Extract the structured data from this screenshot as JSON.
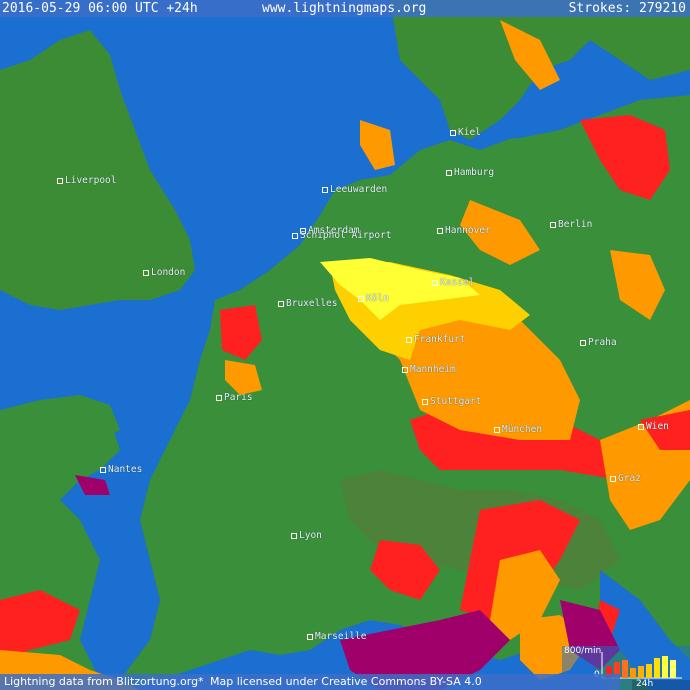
{
  "header": {
    "datetime": "2016-05-29 06:00 UTC +24h",
    "site": "www.lightningmaps.org",
    "strokes_label": "Strokes: 279210"
  },
  "footer": {
    "source_credit": "Lightning data from Blitzortung.org",
    "separator": "*",
    "license_credit": "Map licensed under Creative Commons BY-SA 4.0"
  },
  "cities": [
    {
      "name": "Liverpool",
      "key": "liverpool"
    },
    {
      "name": "London",
      "key": "london"
    },
    {
      "name": "Leeuwarden",
      "key": "leeuwarden"
    },
    {
      "name": "Amsterdam",
      "key": "amsterdam"
    },
    {
      "name": "Schiphol Airport",
      "key": "schiphol"
    },
    {
      "name": "Bruxelles",
      "key": "bruxelles"
    },
    {
      "name": "Köln",
      "key": "koln"
    },
    {
      "name": "Kiel",
      "key": "kiel"
    },
    {
      "name": "Hamburg",
      "key": "hamburg"
    },
    {
      "name": "Hannover",
      "key": "hannover"
    },
    {
      "name": "Berlin",
      "key": "berlin"
    },
    {
      "name": "Kassel",
      "key": "kassel"
    },
    {
      "name": "Frankfurt",
      "key": "frankfurt"
    },
    {
      "name": "Mannheim",
      "key": "mannheim"
    },
    {
      "name": "Stuttgart",
      "key": "stuttgart"
    },
    {
      "name": "München",
      "key": "munchen"
    },
    {
      "name": "Praha",
      "key": "praha"
    },
    {
      "name": "Wien",
      "key": "wien"
    },
    {
      "name": "Graz",
      "key": "graz"
    },
    {
      "name": "Paris",
      "key": "paris"
    },
    {
      "name": "Nantes",
      "key": "nantes"
    },
    {
      "name": "Lyon",
      "key": "lyon"
    },
    {
      "name": "Marseille",
      "key": "marseille"
    }
  ],
  "legend": {
    "rate_label": "800/min",
    "zero_label": "0",
    "time_label": "24h"
  },
  "colors": {
    "sea": "#1a6fd0",
    "land": "#3a8f3a",
    "strike_recent": "#ffff00",
    "strike_mid": "#ff9900",
    "strike_old": "#ff2020",
    "strike_oldest": "#a0006a"
  }
}
